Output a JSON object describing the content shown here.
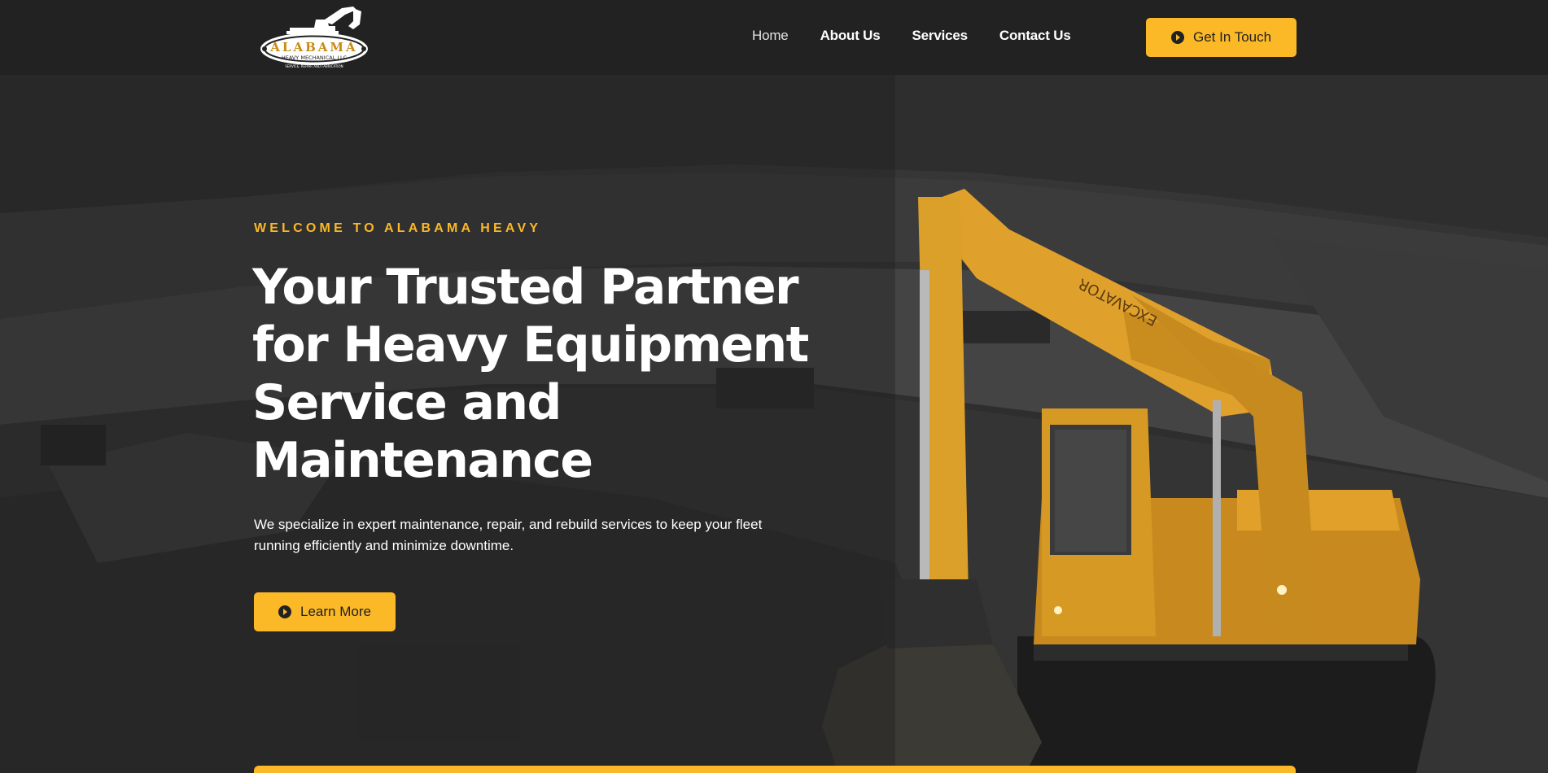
{
  "brand": {
    "logo_name": "ALABAMA",
    "logo_sub": "HEAVY MECHANICAL LLC",
    "logo_tag": "SERVICE, REPAIR AND FABRICATION",
    "accent": "#fbb827",
    "dark": "#222222"
  },
  "nav": {
    "items": [
      {
        "label": "Home",
        "active": true
      },
      {
        "label": "About Us"
      },
      {
        "label": "Services"
      },
      {
        "label": "Contact Us"
      }
    ],
    "cta_label": "Get In Touch",
    "cta_icon": "arrow-circle-right-icon"
  },
  "hero": {
    "kicker": "WELCOME TO ALABAMA HEAVY",
    "headline": "Your Trusted Partner for Heavy Equipment Service and Maintenance",
    "description": "We specialize in expert maintenance, repair, and rebuild services to keep your fleet running efficiently and minimize downtime.",
    "button_label": "Learn More",
    "button_icon": "arrow-circle-right-icon",
    "image": "excavator-in-quarry",
    "excavator_arm_text": "EXCAVATOR"
  }
}
